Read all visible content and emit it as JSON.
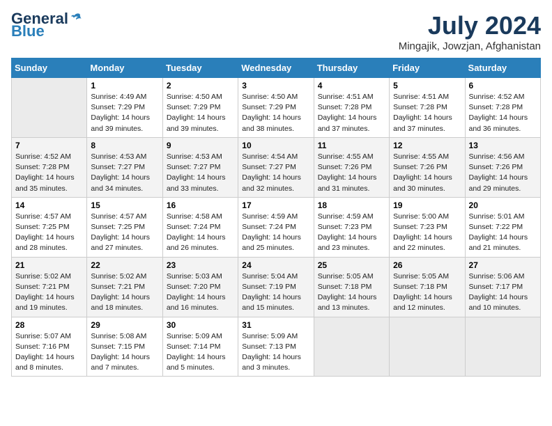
{
  "header": {
    "logo_general": "General",
    "logo_blue": "Blue",
    "title": "July 2024",
    "subtitle": "Mingajik, Jowzjan, Afghanistan"
  },
  "calendar": {
    "columns": [
      "Sunday",
      "Monday",
      "Tuesday",
      "Wednesday",
      "Thursday",
      "Friday",
      "Saturday"
    ],
    "weeks": [
      [
        {
          "date": "",
          "info": ""
        },
        {
          "date": "1",
          "info": "Sunrise: 4:49 AM\nSunset: 7:29 PM\nDaylight: 14 hours\nand 39 minutes."
        },
        {
          "date": "2",
          "info": "Sunrise: 4:50 AM\nSunset: 7:29 PM\nDaylight: 14 hours\nand 39 minutes."
        },
        {
          "date": "3",
          "info": "Sunrise: 4:50 AM\nSunset: 7:29 PM\nDaylight: 14 hours\nand 38 minutes."
        },
        {
          "date": "4",
          "info": "Sunrise: 4:51 AM\nSunset: 7:28 PM\nDaylight: 14 hours\nand 37 minutes."
        },
        {
          "date": "5",
          "info": "Sunrise: 4:51 AM\nSunset: 7:28 PM\nDaylight: 14 hours\nand 37 minutes."
        },
        {
          "date": "6",
          "info": "Sunrise: 4:52 AM\nSunset: 7:28 PM\nDaylight: 14 hours\nand 36 minutes."
        }
      ],
      [
        {
          "date": "7",
          "info": "Sunrise: 4:52 AM\nSunset: 7:28 PM\nDaylight: 14 hours\nand 35 minutes."
        },
        {
          "date": "8",
          "info": "Sunrise: 4:53 AM\nSunset: 7:27 PM\nDaylight: 14 hours\nand 34 minutes."
        },
        {
          "date": "9",
          "info": "Sunrise: 4:53 AM\nSunset: 7:27 PM\nDaylight: 14 hours\nand 33 minutes."
        },
        {
          "date": "10",
          "info": "Sunrise: 4:54 AM\nSunset: 7:27 PM\nDaylight: 14 hours\nand 32 minutes."
        },
        {
          "date": "11",
          "info": "Sunrise: 4:55 AM\nSunset: 7:26 PM\nDaylight: 14 hours\nand 31 minutes."
        },
        {
          "date": "12",
          "info": "Sunrise: 4:55 AM\nSunset: 7:26 PM\nDaylight: 14 hours\nand 30 minutes."
        },
        {
          "date": "13",
          "info": "Sunrise: 4:56 AM\nSunset: 7:26 PM\nDaylight: 14 hours\nand 29 minutes."
        }
      ],
      [
        {
          "date": "14",
          "info": "Sunrise: 4:57 AM\nSunset: 7:25 PM\nDaylight: 14 hours\nand 28 minutes."
        },
        {
          "date": "15",
          "info": "Sunrise: 4:57 AM\nSunset: 7:25 PM\nDaylight: 14 hours\nand 27 minutes."
        },
        {
          "date": "16",
          "info": "Sunrise: 4:58 AM\nSunset: 7:24 PM\nDaylight: 14 hours\nand 26 minutes."
        },
        {
          "date": "17",
          "info": "Sunrise: 4:59 AM\nSunset: 7:24 PM\nDaylight: 14 hours\nand 25 minutes."
        },
        {
          "date": "18",
          "info": "Sunrise: 4:59 AM\nSunset: 7:23 PM\nDaylight: 14 hours\nand 23 minutes."
        },
        {
          "date": "19",
          "info": "Sunrise: 5:00 AM\nSunset: 7:23 PM\nDaylight: 14 hours\nand 22 minutes."
        },
        {
          "date": "20",
          "info": "Sunrise: 5:01 AM\nSunset: 7:22 PM\nDaylight: 14 hours\nand 21 minutes."
        }
      ],
      [
        {
          "date": "21",
          "info": "Sunrise: 5:02 AM\nSunset: 7:21 PM\nDaylight: 14 hours\nand 19 minutes."
        },
        {
          "date": "22",
          "info": "Sunrise: 5:02 AM\nSunset: 7:21 PM\nDaylight: 14 hours\nand 18 minutes."
        },
        {
          "date": "23",
          "info": "Sunrise: 5:03 AM\nSunset: 7:20 PM\nDaylight: 14 hours\nand 16 minutes."
        },
        {
          "date": "24",
          "info": "Sunrise: 5:04 AM\nSunset: 7:19 PM\nDaylight: 14 hours\nand 15 minutes."
        },
        {
          "date": "25",
          "info": "Sunrise: 5:05 AM\nSunset: 7:18 PM\nDaylight: 14 hours\nand 13 minutes."
        },
        {
          "date": "26",
          "info": "Sunrise: 5:05 AM\nSunset: 7:18 PM\nDaylight: 14 hours\nand 12 minutes."
        },
        {
          "date": "27",
          "info": "Sunrise: 5:06 AM\nSunset: 7:17 PM\nDaylight: 14 hours\nand 10 minutes."
        }
      ],
      [
        {
          "date": "28",
          "info": "Sunrise: 5:07 AM\nSunset: 7:16 PM\nDaylight: 14 hours\nand 8 minutes."
        },
        {
          "date": "29",
          "info": "Sunrise: 5:08 AM\nSunset: 7:15 PM\nDaylight: 14 hours\nand 7 minutes."
        },
        {
          "date": "30",
          "info": "Sunrise: 5:09 AM\nSunset: 7:14 PM\nDaylight: 14 hours\nand 5 minutes."
        },
        {
          "date": "31",
          "info": "Sunrise: 5:09 AM\nSunset: 7:13 PM\nDaylight: 14 hours\nand 3 minutes."
        },
        {
          "date": "",
          "info": ""
        },
        {
          "date": "",
          "info": ""
        },
        {
          "date": "",
          "info": ""
        }
      ]
    ]
  }
}
